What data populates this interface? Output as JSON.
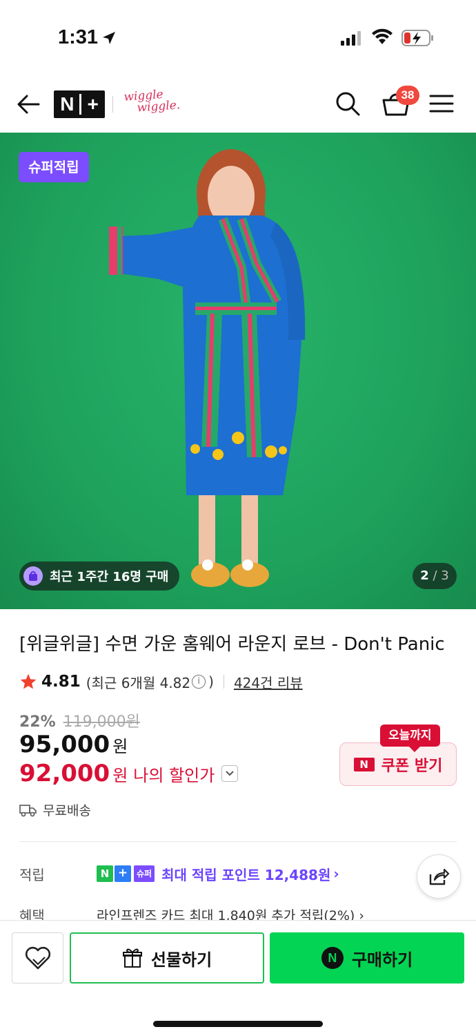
{
  "status_bar": {
    "time": "1:31"
  },
  "header": {
    "logo_text_n": "N",
    "logo_text_plus": "+",
    "brand_line1": "wiggle",
    "brand_line2": "wiggle.",
    "cart_count": "38"
  },
  "hero": {
    "badge": "슈퍼적립",
    "recent_buy": "최근 1주간 16명 구매",
    "page_current": "2",
    "page_sep": " / ",
    "page_total": "3"
  },
  "product": {
    "title": "[위글위글] 수면 가운 홈웨어 라운지 로브 - Don't Panic",
    "rating": "4.81",
    "rating_recent_prefix": "(최근 6개월 4.82",
    "rating_recent_suffix": ")",
    "info_glyph": "i",
    "review_link": "424건 리뷰",
    "discount_pct": "22%",
    "original_price": "119,000원",
    "price": "95,000",
    "price_unit": "원",
    "my_price": "92,000",
    "my_price_unit": "원",
    "my_price_label": "나의 할인가",
    "shipping": "무료배송"
  },
  "coupon": {
    "tag": "오늘까지",
    "icon_text": "N",
    "label": "쿠폰 받기"
  },
  "points": {
    "label": "적립",
    "badge_n": "N",
    "badge_plus": "+",
    "badge_super": "슈퍼",
    "text": "최대 적립 포인트 12,488원",
    "chevron": "›"
  },
  "benefit": {
    "label": "혜택",
    "text": "라인프렌즈 카드 최대 1,840원 추가 적립(2%) ›"
  },
  "bottom_bar": {
    "gift_label": "선물하기",
    "buy_icon": "N",
    "buy_label": "구매하기"
  },
  "colors": {
    "hero_bg": "#1ea25c",
    "accent_purple": "#7b4dff",
    "price_red": "#d90f35",
    "naver_green": "#03d453"
  }
}
